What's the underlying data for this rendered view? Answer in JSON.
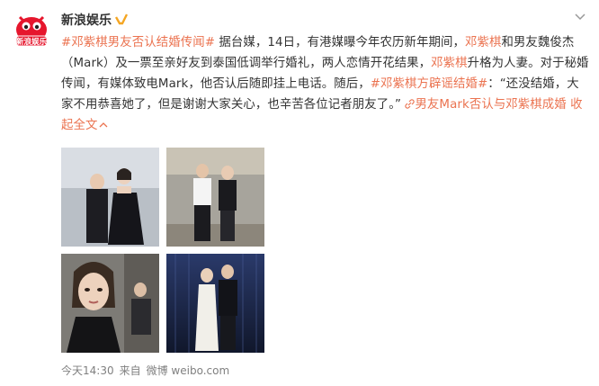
{
  "author": {
    "name": "新浪娱乐",
    "avatar_text": "新浪娱乐"
  },
  "post": {
    "tag1": "#邓紫棋男友否认结婚传闻#",
    "t1": " 据台媒，14日，有港媒曝今年农历新年期间，",
    "name1": "邓紫棋",
    "t2": "和男友魏俊杰（Mark）及一票至亲好友到泰国低调举行婚礼，两人恋情开花结果，",
    "name2": "邓紫棋",
    "t3": "升格为人妻。对于秘婚传闻，有媒体致电Mark，他否认后随即挂上电话。随后，",
    "tag2": "#邓紫棋方辟谣结婚#",
    "t4": "：“还没结婚，大家不用恭喜她了，但是谢谢大家关心，也辛苦各位记者朋友了。”",
    "link_text": "男友Mark否认与邓紫棋成婚",
    "collapse": "收起全文"
  },
  "photos": [
    "photo-1",
    "photo-2",
    "photo-3",
    "photo-4"
  ],
  "footer": {
    "time": "今天14:30",
    "source_prefix": "来自",
    "source": "微博 weibo.com"
  },
  "colors": {
    "accent": "#eb7350",
    "text": "#333333",
    "meta": "#808080"
  }
}
